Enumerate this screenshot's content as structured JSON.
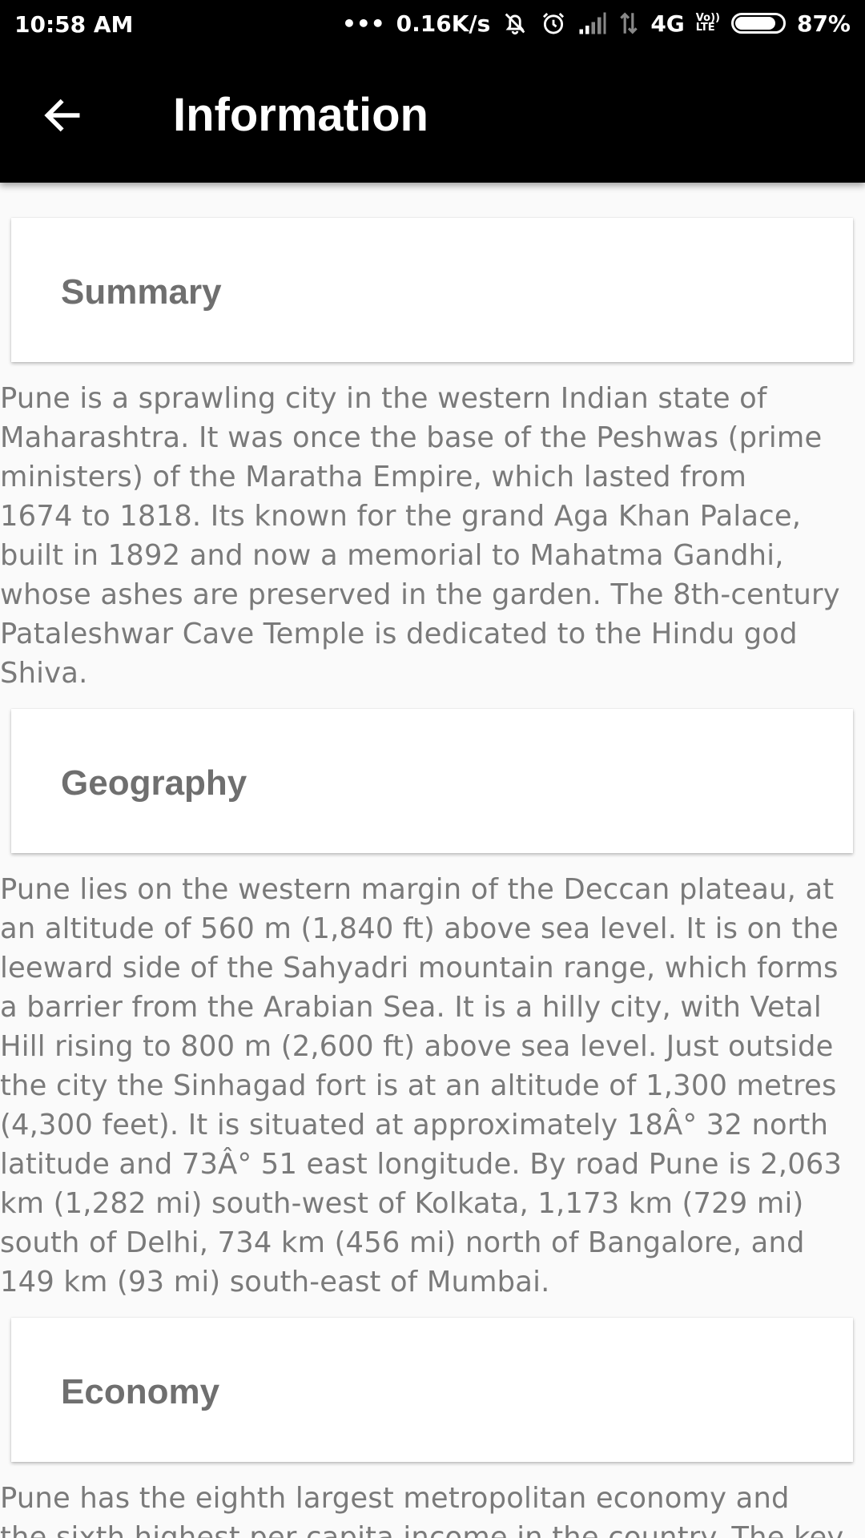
{
  "status_bar": {
    "time": "10:58 AM",
    "dots": "•••",
    "network_speed": "0.16K/s",
    "network_type": "4G",
    "volte_top": "Vo))",
    "volte_bottom": "LTE",
    "battery_percent": "87%",
    "battery_level": 0.87,
    "icons": [
      "more-dots-icon",
      "mute-icon",
      "alarm-icon",
      "signal-icon",
      "data-arrows-icon",
      "battery-icon"
    ]
  },
  "app_bar": {
    "title": "Information",
    "back_icon": "arrow-left-icon"
  },
  "sections": [
    {
      "title": "Summary",
      "lines": [
        "Pune is a sprawling city in the western Indian state of",
        "Maharashtra. It was once the base of the Peshwas (prime",
        "ministers) of the Maratha Empire, which lasted from",
        "1674 to 1818. Its known for the grand Aga Khan Palace,",
        "built in 1892 and now a memorial to Mahatma Gandhi,",
        "whose ashes are preserved in the garden. The 8th-century",
        "Pataleshwar Cave Temple is dedicated to the Hindu god",
        "Shiva."
      ]
    },
    {
      "title": "Geography",
      "lines": [
        "Pune lies on the western margin of the Deccan plateau, at",
        "an altitude of 560 m (1,840 ft) above sea level. It is on the",
        "leeward side of the Sahyadri mountain range, which forms",
        "a barrier from the Arabian Sea. It is a hilly city, with Vetal",
        "Hill rising to 800 m (2,600 ft) above sea level. Just outside",
        "the city the Sinhagad fort is at an altitude of 1,300 metres",
        "(4,300 feet). It is situated at approximately 18Â° 32 north",
        "latitude and 73Â° 51 east longitude. By road Pune is 2,063",
        "km (1,282 mi) south-west of Kolkata, 1,173 km (729 mi)",
        "south of Delhi, 734 km (456 mi) north of Bangalore, and",
        "149 km (93 mi) south-east of Mumbai."
      ]
    },
    {
      "title": "Economy",
      "lines": [
        "Pune has the eighth largest metropolitan economy and",
        "the sixth highest per capita income in the country. The key"
      ]
    }
  ]
}
